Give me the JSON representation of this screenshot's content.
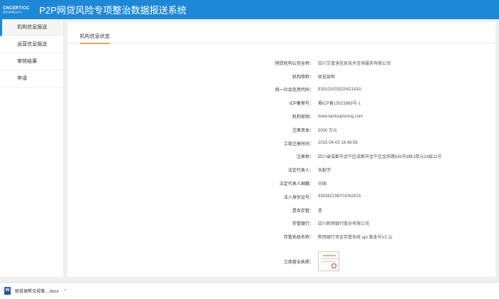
{
  "header": {
    "logo_line1": "CNCERT/CC",
    "logo_line2": "国家互联网应急中心",
    "title": "P2P网贷风险专项整治数据报送系统"
  },
  "sidebar": {
    "items": [
      {
        "label": "机构信息报送"
      },
      {
        "label": "运营信息报送"
      },
      {
        "label": "审核结果"
      },
      {
        "label": "申请"
      }
    ]
  },
  "main": {
    "tab": "机构信息状态",
    "fields": [
      {
        "label": "网贷机构公司全称：",
        "value": "四川艾普洛信息技术咨询服务有限公司"
      },
      {
        "label": "机构简称：",
        "value": "联投银帮"
      },
      {
        "label": "统一社会信用代码：",
        "value": "91510100332042143A"
      },
      {
        "label": "ICP备案号：",
        "value": "蜀ICP备15023969号-1"
      },
      {
        "label": "机构官网：",
        "value": "www.liantoujinrong.com"
      },
      {
        "label": "注册资本：",
        "value": "5000 万元"
      },
      {
        "label": "工商注册时间：",
        "value": "2015-04-03 16:48:56"
      },
      {
        "label": "注册地：",
        "value": "四川省成都市金牛区成都市金牛区金府路593号8栋3单元24层11号"
      },
      {
        "label": "法定代表人：",
        "value": "朱勤学"
      },
      {
        "label": "法定代表人国籍：",
        "value": "中国"
      },
      {
        "label": "法人身份证号：",
        "value": "330382198701062815"
      },
      {
        "label": "是否存管：",
        "value": "是"
      },
      {
        "label": "存管银行：",
        "value": "四川新网银行股份有限公司"
      },
      {
        "label": "存管系统名称：",
        "value": "新网银行资金存管系统 api 版本号V2.11"
      }
    ],
    "license_label": "工商营业执照："
  },
  "downloads": {
    "file_name": "联投银帮合规事....docx"
  }
}
